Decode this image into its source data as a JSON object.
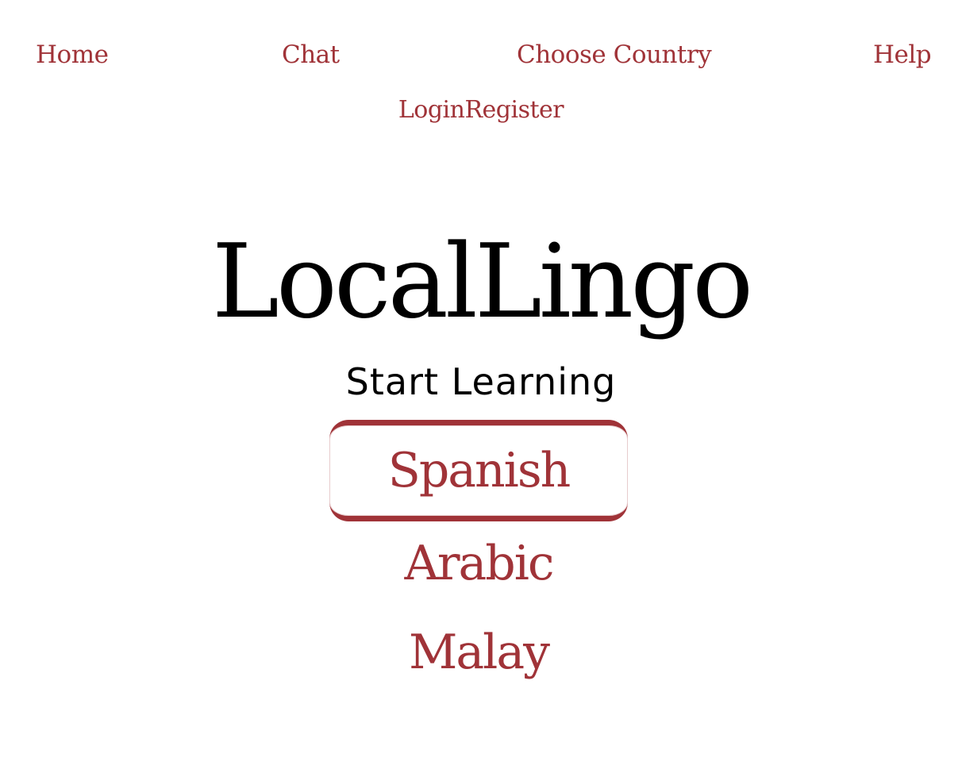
{
  "nav": {
    "home": "Home",
    "chat": "Chat",
    "choose_country": "Choose Country",
    "help": "Help",
    "login": "Login",
    "register": "Register"
  },
  "hero": {
    "brand": "LocalLingo",
    "subtitle": "Start Learning"
  },
  "languages": {
    "selected": "Spanish",
    "items": [
      "Spanish",
      "Arabic",
      "Malay"
    ]
  },
  "colors": {
    "accent": "#a03338",
    "text": "#000000",
    "background": "#ffffff"
  }
}
